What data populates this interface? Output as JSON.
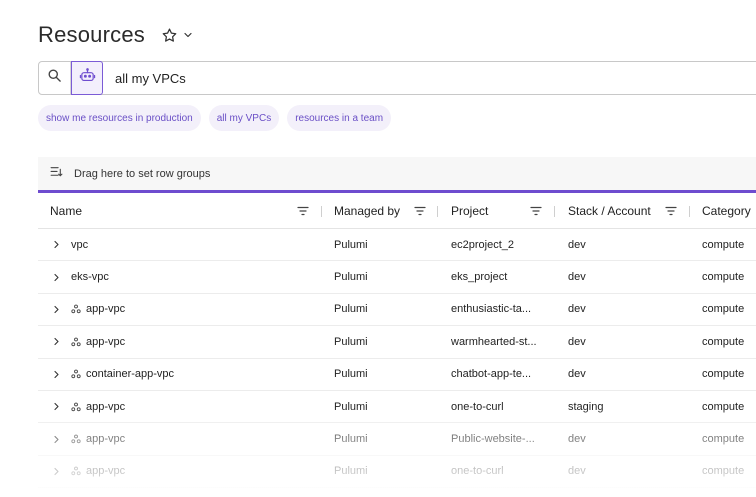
{
  "page": {
    "title": "Resources"
  },
  "search": {
    "value": "all my VPCs",
    "placeholder": ""
  },
  "chips": [
    "show me resources in production",
    "all my VPCs",
    "resources in a team"
  ],
  "grid": {
    "group_bar_label": "Drag here to set row groups",
    "columns": [
      "Name",
      "Managed by",
      "Project",
      "Stack / Account",
      "Category"
    ],
    "rows": [
      {
        "name": "vpc",
        "has_icon": false,
        "managed_by": "Pulumi",
        "project": "ec2project_2",
        "stack": "dev",
        "category": "compute"
      },
      {
        "name": "eks-vpc",
        "has_icon": false,
        "managed_by": "Pulumi",
        "project": "eks_project",
        "stack": "dev",
        "category": "compute"
      },
      {
        "name": "app-vpc",
        "has_icon": true,
        "managed_by": "Pulumi",
        "project": "enthusiastic-ta...",
        "stack": "dev",
        "category": "compute"
      },
      {
        "name": "app-vpc",
        "has_icon": true,
        "managed_by": "Pulumi",
        "project": "warmhearted-st...",
        "stack": "dev",
        "category": "compute"
      },
      {
        "name": "container-app-vpc",
        "has_icon": true,
        "managed_by": "Pulumi",
        "project": "chatbot-app-te...",
        "stack": "dev",
        "category": "compute"
      },
      {
        "name": "app-vpc",
        "has_icon": true,
        "managed_by": "Pulumi",
        "project": "one-to-curl",
        "stack": "staging",
        "category": "compute"
      },
      {
        "name": "app-vpc",
        "has_icon": true,
        "managed_by": "Pulumi",
        "project": "Public-website-...",
        "stack": "dev",
        "category": "compute"
      },
      {
        "name": "app-vpc",
        "has_icon": true,
        "managed_by": "Pulumi",
        "project": "one-to-curl",
        "stack": "dev",
        "category": "compute"
      }
    ]
  },
  "colors": {
    "accent": "#6e4ccf",
    "chip_bg": "#f3f0fa",
    "chip_text": "#6a4fc6"
  },
  "icons": [
    "star-icon",
    "chevron-down-icon",
    "search-icon",
    "robot-icon",
    "row-groups-icon",
    "filter-icon",
    "chevron-right-icon",
    "component-icon"
  ]
}
